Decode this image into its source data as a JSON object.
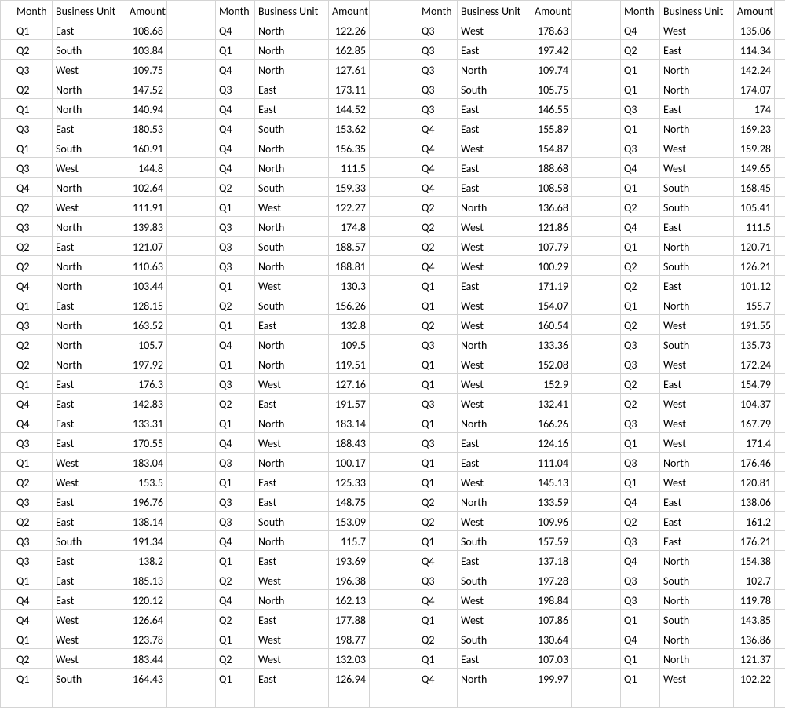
{
  "headers": {
    "month": "Month",
    "bu": "Business Unit",
    "amount": "Amount"
  },
  "blocks": [
    [
      {
        "m": "Q1",
        "b": "East",
        "a": "108.68"
      },
      {
        "m": "Q2",
        "b": "South",
        "a": "103.84"
      },
      {
        "m": "Q3",
        "b": "West",
        "a": "109.75"
      },
      {
        "m": "Q2",
        "b": "North",
        "a": "147.52"
      },
      {
        "m": "Q1",
        "b": "North",
        "a": "140.94"
      },
      {
        "m": "Q3",
        "b": "East",
        "a": "180.53"
      },
      {
        "m": "Q1",
        "b": "South",
        "a": "160.91"
      },
      {
        "m": "Q3",
        "b": "West",
        "a": "144.8"
      },
      {
        "m": "Q4",
        "b": "North",
        "a": "102.64"
      },
      {
        "m": "Q2",
        "b": "West",
        "a": "111.91"
      },
      {
        "m": "Q3",
        "b": "North",
        "a": "139.83"
      },
      {
        "m": "Q2",
        "b": "East",
        "a": "121.07"
      },
      {
        "m": "Q2",
        "b": "North",
        "a": "110.63"
      },
      {
        "m": "Q4",
        "b": "North",
        "a": "103.44"
      },
      {
        "m": "Q1",
        "b": "East",
        "a": "128.15"
      },
      {
        "m": "Q3",
        "b": "North",
        "a": "163.52"
      },
      {
        "m": "Q2",
        "b": "North",
        "a": "105.7"
      },
      {
        "m": "Q2",
        "b": "North",
        "a": "197.92"
      },
      {
        "m": "Q1",
        "b": "East",
        "a": "176.3"
      },
      {
        "m": "Q4",
        "b": "East",
        "a": "142.83"
      },
      {
        "m": "Q4",
        "b": "East",
        "a": "133.31"
      },
      {
        "m": "Q3",
        "b": "East",
        "a": "170.55"
      },
      {
        "m": "Q1",
        "b": "West",
        "a": "183.04"
      },
      {
        "m": "Q2",
        "b": "West",
        "a": "153.5"
      },
      {
        "m": "Q3",
        "b": "East",
        "a": "196.76"
      },
      {
        "m": "Q2",
        "b": "East",
        "a": "138.14"
      },
      {
        "m": "Q3",
        "b": "South",
        "a": "191.34"
      },
      {
        "m": "Q3",
        "b": "East",
        "a": "138.2"
      },
      {
        "m": "Q1",
        "b": "East",
        "a": "185.13"
      },
      {
        "m": "Q4",
        "b": "East",
        "a": "120.12"
      },
      {
        "m": "Q4",
        "b": "West",
        "a": "126.64"
      },
      {
        "m": "Q1",
        "b": "West",
        "a": "123.78"
      },
      {
        "m": "Q2",
        "b": "West",
        "a": "183.44"
      },
      {
        "m": "Q1",
        "b": "South",
        "a": "164.43"
      }
    ],
    [
      {
        "m": "Q4",
        "b": "North",
        "a": "122.26"
      },
      {
        "m": "Q1",
        "b": "North",
        "a": "162.85"
      },
      {
        "m": "Q4",
        "b": "North",
        "a": "127.61"
      },
      {
        "m": "Q3",
        "b": "East",
        "a": "173.11"
      },
      {
        "m": "Q4",
        "b": "East",
        "a": "144.52"
      },
      {
        "m": "Q4",
        "b": "South",
        "a": "153.62"
      },
      {
        "m": "Q4",
        "b": "North",
        "a": "156.35"
      },
      {
        "m": "Q4",
        "b": "North",
        "a": "111.5"
      },
      {
        "m": "Q2",
        "b": "South",
        "a": "159.33"
      },
      {
        "m": "Q1",
        "b": "West",
        "a": "122.27"
      },
      {
        "m": "Q3",
        "b": "North",
        "a": "174.8"
      },
      {
        "m": "Q3",
        "b": "South",
        "a": "188.57"
      },
      {
        "m": "Q3",
        "b": "North",
        "a": "188.81"
      },
      {
        "m": "Q1",
        "b": "West",
        "a": "130.3"
      },
      {
        "m": "Q2",
        "b": "South",
        "a": "156.26"
      },
      {
        "m": "Q1",
        "b": "East",
        "a": "132.8"
      },
      {
        "m": "Q4",
        "b": "North",
        "a": "109.5"
      },
      {
        "m": "Q1",
        "b": "North",
        "a": "119.51"
      },
      {
        "m": "Q3",
        "b": "West",
        "a": "127.16"
      },
      {
        "m": "Q2",
        "b": "East",
        "a": "191.57"
      },
      {
        "m": "Q1",
        "b": "North",
        "a": "183.14"
      },
      {
        "m": "Q4",
        "b": "West",
        "a": "188.43"
      },
      {
        "m": "Q3",
        "b": "North",
        "a": "100.17"
      },
      {
        "m": "Q1",
        "b": "East",
        "a": "125.33"
      },
      {
        "m": "Q3",
        "b": "East",
        "a": "148.75"
      },
      {
        "m": "Q3",
        "b": "South",
        "a": "153.09"
      },
      {
        "m": "Q4",
        "b": "North",
        "a": "115.7"
      },
      {
        "m": "Q1",
        "b": "East",
        "a": "193.69"
      },
      {
        "m": "Q2",
        "b": "West",
        "a": "196.38"
      },
      {
        "m": "Q4",
        "b": "North",
        "a": "162.13"
      },
      {
        "m": "Q2",
        "b": "East",
        "a": "177.88"
      },
      {
        "m": "Q1",
        "b": "West",
        "a": "198.77"
      },
      {
        "m": "Q2",
        "b": "West",
        "a": "132.03"
      },
      {
        "m": "Q1",
        "b": "East",
        "a": "126.94"
      }
    ],
    [
      {
        "m": "Q3",
        "b": "West",
        "a": "178.63"
      },
      {
        "m": "Q3",
        "b": "East",
        "a": "197.42"
      },
      {
        "m": "Q3",
        "b": "North",
        "a": "109.74"
      },
      {
        "m": "Q3",
        "b": "South",
        "a": "105.75"
      },
      {
        "m": "Q3",
        "b": "East",
        "a": "146.55"
      },
      {
        "m": "Q4",
        "b": "East",
        "a": "155.89"
      },
      {
        "m": "Q4",
        "b": "West",
        "a": "154.87"
      },
      {
        "m": "Q4",
        "b": "East",
        "a": "188.68"
      },
      {
        "m": "Q4",
        "b": "East",
        "a": "108.58"
      },
      {
        "m": "Q2",
        "b": "North",
        "a": "136.68"
      },
      {
        "m": "Q2",
        "b": "West",
        "a": "121.86"
      },
      {
        "m": "Q2",
        "b": "West",
        "a": "107.79"
      },
      {
        "m": "Q4",
        "b": "West",
        "a": "100.29"
      },
      {
        "m": "Q1",
        "b": "East",
        "a": "171.19"
      },
      {
        "m": "Q1",
        "b": "West",
        "a": "154.07"
      },
      {
        "m": "Q2",
        "b": "West",
        "a": "160.54"
      },
      {
        "m": "Q3",
        "b": "North",
        "a": "133.36"
      },
      {
        "m": "Q1",
        "b": "West",
        "a": "152.08"
      },
      {
        "m": "Q1",
        "b": "West",
        "a": "152.9"
      },
      {
        "m": "Q3",
        "b": "West",
        "a": "132.41"
      },
      {
        "m": "Q1",
        "b": "North",
        "a": "166.26"
      },
      {
        "m": "Q3",
        "b": "East",
        "a": "124.16"
      },
      {
        "m": "Q1",
        "b": "East",
        "a": "111.04"
      },
      {
        "m": "Q1",
        "b": "West",
        "a": "145.13"
      },
      {
        "m": "Q2",
        "b": "North",
        "a": "133.59"
      },
      {
        "m": "Q2",
        "b": "West",
        "a": "109.96"
      },
      {
        "m": "Q1",
        "b": "South",
        "a": "157.59"
      },
      {
        "m": "Q4",
        "b": "East",
        "a": "137.18"
      },
      {
        "m": "Q3",
        "b": "South",
        "a": "197.28"
      },
      {
        "m": "Q4",
        "b": "West",
        "a": "198.84"
      },
      {
        "m": "Q1",
        "b": "West",
        "a": "107.86"
      },
      {
        "m": "Q2",
        "b": "South",
        "a": "130.64"
      },
      {
        "m": "Q1",
        "b": "East",
        "a": "107.03"
      },
      {
        "m": "Q4",
        "b": "North",
        "a": "199.97"
      }
    ],
    [
      {
        "m": "Q4",
        "b": "West",
        "a": "135.06"
      },
      {
        "m": "Q2",
        "b": "East",
        "a": "114.34"
      },
      {
        "m": "Q1",
        "b": "North",
        "a": "142.24"
      },
      {
        "m": "Q1",
        "b": "North",
        "a": "174.07"
      },
      {
        "m": "Q3",
        "b": "East",
        "a": "174"
      },
      {
        "m": "Q1",
        "b": "North",
        "a": "169.23"
      },
      {
        "m": "Q3",
        "b": "West",
        "a": "159.28"
      },
      {
        "m": "Q4",
        "b": "West",
        "a": "149.65"
      },
      {
        "m": "Q1",
        "b": "South",
        "a": "168.45"
      },
      {
        "m": "Q2",
        "b": "South",
        "a": "105.41"
      },
      {
        "m": "Q4",
        "b": "East",
        "a": "111.5"
      },
      {
        "m": "Q1",
        "b": "North",
        "a": "120.71"
      },
      {
        "m": "Q2",
        "b": "South",
        "a": "126.21"
      },
      {
        "m": "Q2",
        "b": "East",
        "a": "101.12"
      },
      {
        "m": "Q1",
        "b": "North",
        "a": "155.7"
      },
      {
        "m": "Q2",
        "b": "West",
        "a": "191.55"
      },
      {
        "m": "Q3",
        "b": "South",
        "a": "135.73"
      },
      {
        "m": "Q3",
        "b": "West",
        "a": "172.24"
      },
      {
        "m": "Q2",
        "b": "East",
        "a": "154.79"
      },
      {
        "m": "Q2",
        "b": "West",
        "a": "104.37"
      },
      {
        "m": "Q3",
        "b": "West",
        "a": "167.79"
      },
      {
        "m": "Q1",
        "b": "West",
        "a": "171.4"
      },
      {
        "m": "Q3",
        "b": "North",
        "a": "176.46"
      },
      {
        "m": "Q1",
        "b": "West",
        "a": "120.81"
      },
      {
        "m": "Q4",
        "b": "East",
        "a": "138.06"
      },
      {
        "m": "Q2",
        "b": "East",
        "a": "161.2"
      },
      {
        "m": "Q3",
        "b": "East",
        "a": "176.21"
      },
      {
        "m": "Q4",
        "b": "North",
        "a": "154.38"
      },
      {
        "m": "Q3",
        "b": "South",
        "a": "102.7"
      },
      {
        "m": "Q3",
        "b": "North",
        "a": "119.78"
      },
      {
        "m": "Q1",
        "b": "South",
        "a": "143.85"
      },
      {
        "m": "Q4",
        "b": "North",
        "a": "136.86"
      },
      {
        "m": "Q1",
        "b": "North",
        "a": "121.37"
      },
      {
        "m": "Q1",
        "b": "West",
        "a": "102.22"
      }
    ]
  ]
}
